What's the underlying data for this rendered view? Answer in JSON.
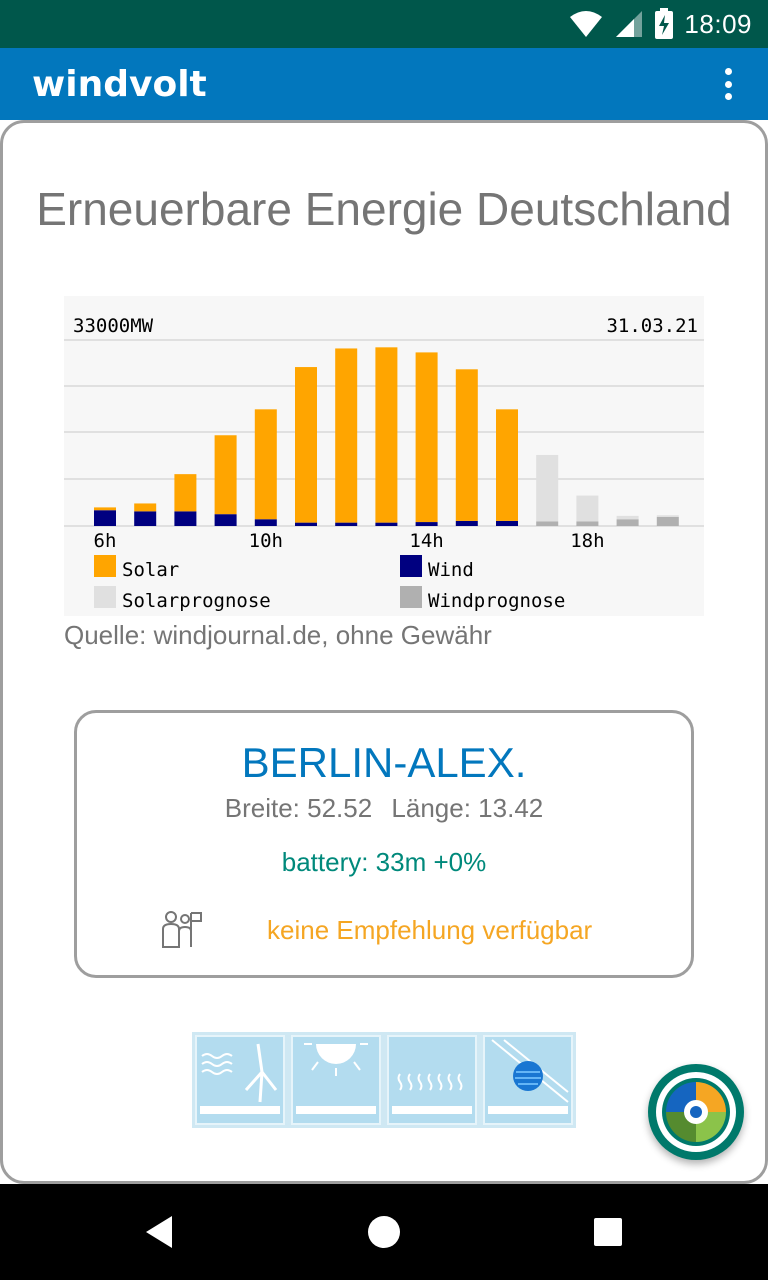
{
  "status_bar": {
    "time": "18:09"
  },
  "app_bar": {
    "title": "windvolt"
  },
  "page_title": "Erneuerbare Energie Deutschland",
  "chart": {
    "top_left_label": "33000MW",
    "top_right_label": "31.03.21",
    "legend": {
      "solar": "Solar",
      "wind": "Wind",
      "solar_forecast": "Solarprognose",
      "wind_forecast": "Windprognose"
    }
  },
  "chart_data": {
    "type": "bar",
    "stacked": true,
    "x_tick_labels": [
      "6h",
      "10h",
      "14h",
      "18h"
    ],
    "ymax_label": "33000MW",
    "date": "31.03.21",
    "grid": true,
    "legend_position": "bottom",
    "categories": [
      "6h",
      "7h",
      "8h",
      "9h",
      "10h",
      "11h",
      "12h",
      "13h",
      "14h",
      "15h",
      "16h",
      "17h",
      "18h",
      "19h",
      "20h"
    ],
    "series": [
      {
        "name": "Wind",
        "values": [
          2800,
          2600,
          2600,
          2100,
          1200,
          600,
          600,
          600,
          700,
          900,
          900,
          null,
          null,
          null,
          null
        ]
      },
      {
        "name": "Solar",
        "values": [
          500,
          1400,
          6600,
          14000,
          19500,
          27600,
          30900,
          31100,
          30100,
          26900,
          19800,
          null,
          null,
          null,
          null
        ]
      },
      {
        "name": "Windprognose",
        "values": [
          null,
          null,
          null,
          null,
          null,
          null,
          null,
          null,
          null,
          null,
          null,
          800,
          800,
          1200,
          1600
        ]
      },
      {
        "name": "Solarprognose",
        "values": [
          null,
          null,
          null,
          null,
          null,
          null,
          null,
          null,
          null,
          null,
          null,
          11800,
          4600,
          600,
          300
        ]
      }
    ],
    "colors": {
      "Solar": "#ffa500",
      "Wind": "#000080",
      "Solarprognose": "#e0e0e0",
      "Windprognose": "#b0b0b0"
    },
    "ylim": [
      0,
      33000
    ]
  },
  "source_text": "Quelle: windjournal.de, ohne Gewähr",
  "station": {
    "name": "BERLIN-ALEX.",
    "latitude": "Breite: 52.52",
    "longitude": "Länge: 13.42",
    "battery": "battery: 33m +0%",
    "recommendation": "keine Empfehlung verfügbar"
  },
  "colors": {
    "status_bar": "#00574b",
    "app_bar": "#0277bd",
    "accent_blue": "#0277bd",
    "battery_teal": "#00897b",
    "recommend_orange": "#f5a623",
    "fab": "#00796b"
  },
  "icons": [
    "wifi-icon",
    "signal-icon",
    "battery-charging-icon",
    "overflow-menu-icon",
    "people-flag-icon",
    "wind-turbine-icon",
    "sun-icon",
    "heat-icon",
    "solar-panel-icon",
    "app-logo-icon",
    "back-icon",
    "home-icon",
    "recents-icon"
  ]
}
